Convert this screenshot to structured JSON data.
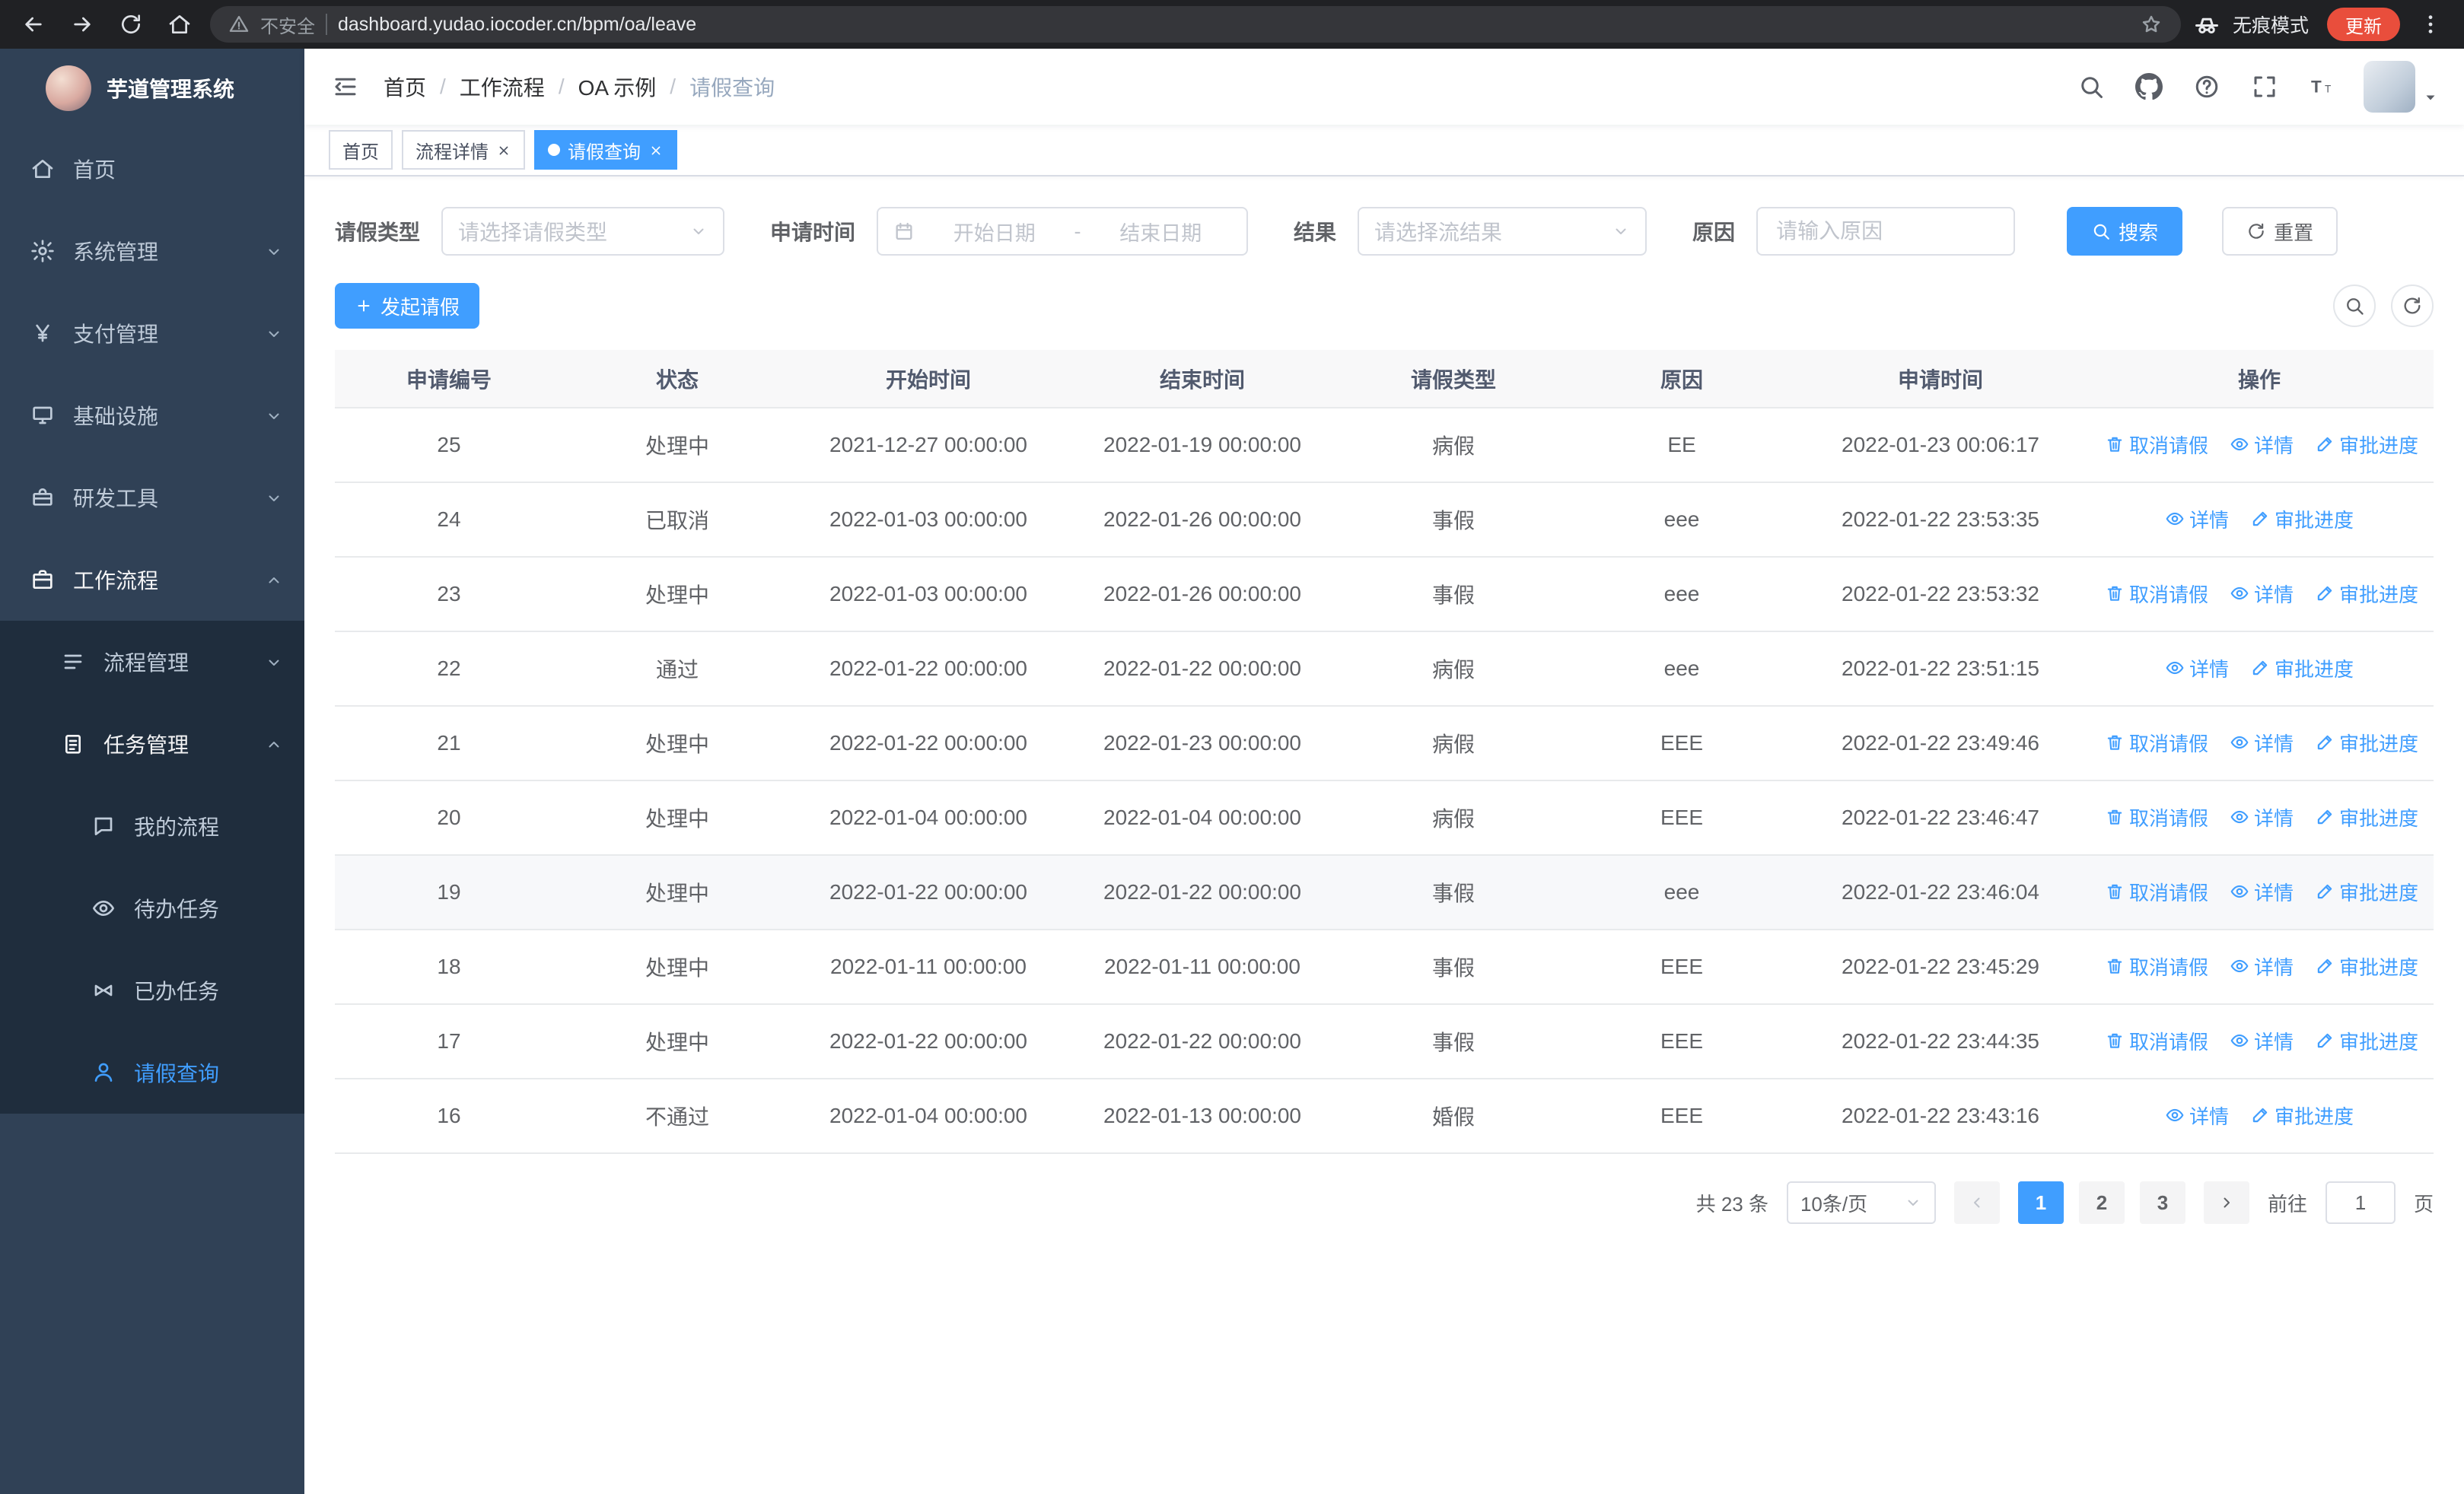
{
  "browser": {
    "security_label": "不安全",
    "url": "dashboard.yudao.iocoder.cn/bpm/oa/leave",
    "incognito_label": "无痕模式",
    "update_label": "更新"
  },
  "colors": {
    "primary": "#409eff",
    "sidebar_bg": "#304156",
    "submenu_bg": "#1f2d3d",
    "active_tab_bg": "#409eff",
    "update_badge": "#e94e3c",
    "link": "#409eff"
  },
  "sidebar": {
    "app_title": "芋道管理系统",
    "menu": [
      {
        "name": "home",
        "label": "首页",
        "icon": "home-icon",
        "level": 0,
        "arrow": "",
        "sub": false
      },
      {
        "name": "system-management",
        "label": "系统管理",
        "icon": "gear-icon",
        "level": 0,
        "arrow": "down",
        "sub": false
      },
      {
        "name": "payment-management",
        "label": "支付管理",
        "icon": "yen-icon",
        "level": 0,
        "arrow": "down",
        "sub": false
      },
      {
        "name": "infrastructure",
        "label": "基础设施",
        "icon": "infrastructure-icon",
        "level": 0,
        "arrow": "down",
        "sub": false
      },
      {
        "name": "dev-tools",
        "label": "研发工具",
        "icon": "devtools-icon",
        "level": 0,
        "arrow": "down",
        "sub": false
      },
      {
        "name": "workflow",
        "label": "工作流程",
        "icon": "workflow-icon",
        "level": 0,
        "arrow": "up",
        "sub": false,
        "open": true
      },
      {
        "name": "process-management",
        "label": "流程管理",
        "icon": "process-list-icon",
        "level": 1,
        "arrow": "down",
        "sub": true
      },
      {
        "name": "task-management",
        "label": "任务管理",
        "icon": "task-icon",
        "level": 1,
        "arrow": "up",
        "sub": true,
        "open": true
      },
      {
        "name": "my-process",
        "label": "我的流程",
        "icon": "chat-icon",
        "level": 2,
        "arrow": "",
        "sub": true
      },
      {
        "name": "todo-tasks",
        "label": "待办任务",
        "icon": "eye-icon",
        "level": 2,
        "arrow": "",
        "sub": true
      },
      {
        "name": "done-tasks",
        "label": "已办任务",
        "icon": "done-icon",
        "level": 2,
        "arrow": "",
        "sub": true
      },
      {
        "name": "leave-query",
        "label": "请假查询",
        "icon": "user-icon",
        "level": 2,
        "arrow": "",
        "sub": true,
        "active": true
      }
    ]
  },
  "navbar": {
    "breadcrumb": [
      "首页",
      "工作流程",
      "OA 示例",
      "请假查询"
    ]
  },
  "tags_view": {
    "tabs": [
      {
        "name": "home",
        "label": "首页",
        "closable": false,
        "active": false
      },
      {
        "name": "process-detail",
        "label": "流程详情",
        "closable": true,
        "active": false
      },
      {
        "name": "leave-query",
        "label": "请假查询",
        "closable": true,
        "active": true
      }
    ]
  },
  "filters": {
    "leave_type": {
      "label": "请假类型",
      "placeholder": "请选择请假类型"
    },
    "apply_time": {
      "label": "申请时间",
      "start_placeholder": "开始日期",
      "separator": "-",
      "end_placeholder": "结束日期"
    },
    "result": {
      "label": "结果",
      "placeholder": "请选择流结果"
    },
    "reason": {
      "label": "原因",
      "placeholder": "请输入原因"
    },
    "search_button": "搜索",
    "reset_button": "重置"
  },
  "toolbar": {
    "create_button": "发起请假"
  },
  "table": {
    "headers": [
      "申请编号",
      "状态",
      "开始时间",
      "结束时间",
      "请假类型",
      "原因",
      "申请时间",
      "操作"
    ],
    "action_labels": {
      "cancel": "取消请假",
      "detail": "详情",
      "progress": "审批进度"
    },
    "rows": [
      {
        "id": "25",
        "status": "处理中",
        "start_time": "2021-12-27 00:00:00",
        "end_time": "2022-01-19 00:00:00",
        "leave_type": "病假",
        "reason": "EE",
        "apply_time": "2022-01-23 00:06:17",
        "actions": [
          "cancel",
          "detail",
          "progress"
        ],
        "highlighted": false
      },
      {
        "id": "24",
        "status": "已取消",
        "start_time": "2022-01-03 00:00:00",
        "end_time": "2022-01-26 00:00:00",
        "leave_type": "事假",
        "reason": "eee",
        "apply_time": "2022-01-22 23:53:35",
        "actions": [
          "detail",
          "progress"
        ],
        "highlighted": false
      },
      {
        "id": "23",
        "status": "处理中",
        "start_time": "2022-01-03 00:00:00",
        "end_time": "2022-01-26 00:00:00",
        "leave_type": "事假",
        "reason": "eee",
        "apply_time": "2022-01-22 23:53:32",
        "actions": [
          "cancel",
          "detail",
          "progress"
        ],
        "highlighted": false
      },
      {
        "id": "22",
        "status": "通过",
        "start_time": "2022-01-22 00:00:00",
        "end_time": "2022-01-22 00:00:00",
        "leave_type": "病假",
        "reason": "eee",
        "apply_time": "2022-01-22 23:51:15",
        "actions": [
          "detail",
          "progress"
        ],
        "highlighted": false
      },
      {
        "id": "21",
        "status": "处理中",
        "start_time": "2022-01-22 00:00:00",
        "end_time": "2022-01-23 00:00:00",
        "leave_type": "病假",
        "reason": "EEE",
        "apply_time": "2022-01-22 23:49:46",
        "actions": [
          "cancel",
          "detail",
          "progress"
        ],
        "highlighted": false
      },
      {
        "id": "20",
        "status": "处理中",
        "start_time": "2022-01-04 00:00:00",
        "end_time": "2022-01-04 00:00:00",
        "leave_type": "病假",
        "reason": "EEE",
        "apply_time": "2022-01-22 23:46:47",
        "actions": [
          "cancel",
          "detail",
          "progress"
        ],
        "highlighted": false
      },
      {
        "id": "19",
        "status": "处理中",
        "start_time": "2022-01-22 00:00:00",
        "end_time": "2022-01-22 00:00:00",
        "leave_type": "事假",
        "reason": "eee",
        "apply_time": "2022-01-22 23:46:04",
        "actions": [
          "cancel",
          "detail",
          "progress"
        ],
        "highlighted": true
      },
      {
        "id": "18",
        "status": "处理中",
        "start_time": "2022-01-11 00:00:00",
        "end_time": "2022-01-11 00:00:00",
        "leave_type": "事假",
        "reason": "EEE",
        "apply_time": "2022-01-22 23:45:29",
        "actions": [
          "cancel",
          "detail",
          "progress"
        ],
        "highlighted": false
      },
      {
        "id": "17",
        "status": "处理中",
        "start_time": "2022-01-22 00:00:00",
        "end_time": "2022-01-22 00:00:00",
        "leave_type": "事假",
        "reason": "EEE",
        "apply_time": "2022-01-22 23:44:35",
        "actions": [
          "cancel",
          "detail",
          "progress"
        ],
        "highlighted": false
      },
      {
        "id": "16",
        "status": "不通过",
        "start_time": "2022-01-04 00:00:00",
        "end_time": "2022-01-13 00:00:00",
        "leave_type": "婚假",
        "reason": "EEE",
        "apply_time": "2022-01-22 23:43:16",
        "actions": [
          "detail",
          "progress"
        ],
        "highlighted": false
      }
    ]
  },
  "pagination": {
    "total_text": "共 23 条",
    "page_size_text": "10条/页",
    "pages": [
      "1",
      "2",
      "3"
    ],
    "active_page": "1",
    "goto_label": "前往",
    "goto_value": "1",
    "goto_suffix": "页"
  }
}
